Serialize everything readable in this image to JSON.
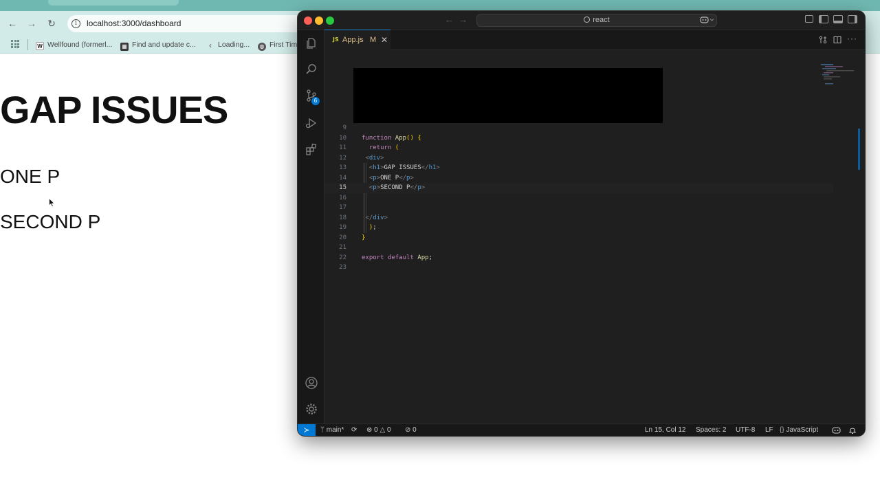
{
  "browser": {
    "url": "localhost:3000/dashboard",
    "bookmarks": [
      {
        "label": "Wellfound (formerl...",
        "icon": "wellfound-favicon",
        "color": "#444444"
      },
      {
        "label": "Find and update c...",
        "icon": "calendar-favicon",
        "color": "#3a3a3a"
      },
      {
        "label": "Loading...",
        "icon": "chevron-favicon",
        "color": "#666666"
      },
      {
        "label": "First Tim",
        "icon": "globe-favicon",
        "color": "#555555"
      }
    ],
    "page": {
      "heading": "GAP ISSUES",
      "paragraphs": [
        "ONE P",
        "SECOND P"
      ]
    }
  },
  "vscode": {
    "command_center": "react",
    "tab": {
      "label": "App.js",
      "file_icon": "JS",
      "modified_marker": "M"
    },
    "source_control_badge": "6",
    "code_lines": [
      {
        "n": "9",
        "html": ""
      },
      {
        "n": "10",
        "html": "<span class=\"kw\">function</span> <span class=\"fn\">App</span><span class=\"brk\">()</span> <span class=\"brk\">{</span>"
      },
      {
        "n": "11",
        "html": "  <span class=\"kw\">return</span> <span class=\"brk\">(</span>"
      },
      {
        "n": "12",
        "html": " <span class=\"punc\">&lt;</span><span class=\"tag\">div</span><span class=\"punc\">&gt;</span>"
      },
      {
        "n": "13",
        "html": "  <span class=\"punc\">&lt;</span><span class=\"tag\">h1</span><span class=\"punc\">&gt;</span><span class=\"txt\">GAP ISSUES</span><span class=\"punc\">&lt;/</span><span class=\"tag\">h1</span><span class=\"punc\">&gt;</span>"
      },
      {
        "n": "14",
        "html": "  <span class=\"punc\">&lt;</span><span class=\"tag\">p</span><span class=\"punc\">&gt;</span><span class=\"txt\">ONE P</span><span class=\"punc\">&lt;/</span><span class=\"tag\">p</span><span class=\"punc\">&gt;</span>"
      },
      {
        "n": "15",
        "html": "  <span class=\"punc\">&lt;</span><span class=\"tag\">p</span><span class=\"punc\">&gt;</span><span class=\"txt\">SECOND P</span><span class=\"punc\">&lt;/</span><span class=\"tag\">p</span><span class=\"punc\">&gt;</span>",
        "current": true
      },
      {
        "n": "16",
        "html": ""
      },
      {
        "n": "17",
        "html": ""
      },
      {
        "n": "18",
        "html": " <span class=\"punc\">&lt;/</span><span class=\"tag\">div</span><span class=\"punc\">&gt;</span>"
      },
      {
        "n": "19",
        "html": "  <span class=\"brk\">)</span><span class=\"txt\">;</span>"
      },
      {
        "n": "20",
        "html": "<span class=\"brk\">}</span>"
      },
      {
        "n": "21",
        "html": ""
      },
      {
        "n": "22",
        "html": "<span class=\"kw\">export</span> <span class=\"kw\">default</span> <span class=\"fn\">App</span><span class=\"txt\">;</span>"
      },
      {
        "n": "23",
        "html": ""
      }
    ],
    "status": {
      "branch": "main*",
      "errors": "0",
      "warnings": "0",
      "ports": "0",
      "cursor_pos": "Ln 15, Col 12",
      "spaces": "Spaces: 2",
      "encoding": "UTF-8",
      "eol": "LF",
      "language": "JavaScript"
    }
  },
  "colors": {
    "accent": "#0078d4",
    "browser_chrome": "#d2ebe8",
    "browser_top": "#6fb8b1",
    "badge": "#0078d4"
  }
}
